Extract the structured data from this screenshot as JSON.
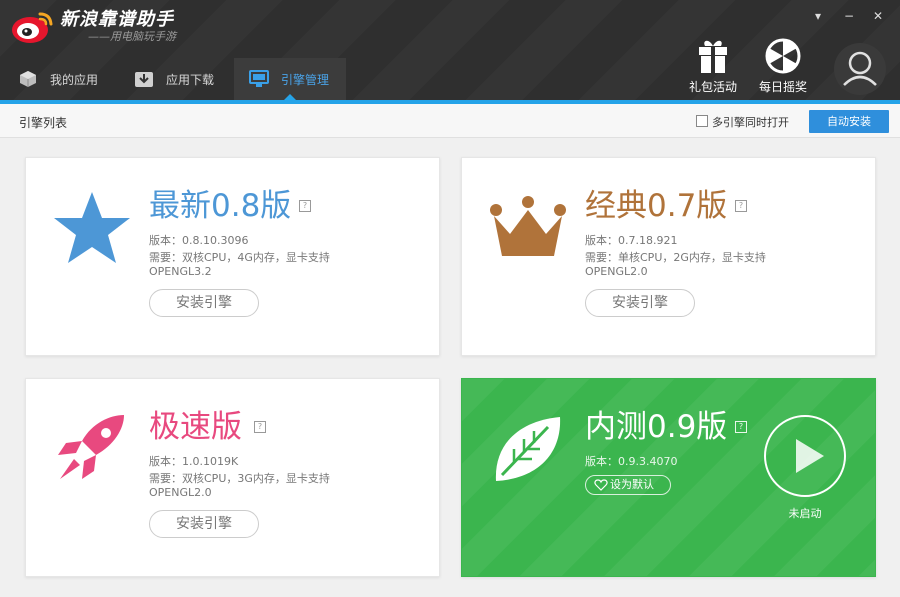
{
  "app": {
    "title": "新浪靠谱助手",
    "subtitle": "——用电脑玩手游",
    "window_controls": {
      "menu": "▾",
      "minimize": "−",
      "close": "✕"
    }
  },
  "nav": {
    "tabs": [
      {
        "label": "我的应用",
        "icon": "cube-icon",
        "active": false
      },
      {
        "label": "应用下载",
        "icon": "download-box-icon",
        "active": false
      },
      {
        "label": "引擎管理",
        "icon": "monitor-icon",
        "active": true
      }
    ]
  },
  "top_actions": {
    "gift": {
      "label": "礼包活动",
      "icon": "gift-icon"
    },
    "lottery": {
      "label": "每日摇奖",
      "icon": "lottery-wheel-icon"
    },
    "avatar_icon": "user-avatar-icon"
  },
  "toolbar": {
    "title": "引擎列表",
    "multi_open_label": "多引擎同时打开",
    "multi_open_checked": false,
    "auto_install_label": "自动安装"
  },
  "engines": [
    {
      "title": "最新0.8版",
      "title_color": "#4d97d6",
      "icon": "star-icon",
      "version": "版本：0.8.10.3096",
      "requirement": "需要：双核CPU，4G内存，显卡支持",
      "requirement2": "OPENGL3.2",
      "action_label": "安装引擎"
    },
    {
      "title": "经典0.7版",
      "title_color": "#b0733a",
      "icon": "crown-icon",
      "version": "版本：0.7.18.921",
      "requirement": "需要：单核CPU，2G内存，显卡支持",
      "requirement2": "OPENGL2.0",
      "action_label": "安装引擎"
    },
    {
      "title": "极速版",
      "title_color": "#e8497f",
      "icon": "rocket-icon",
      "version": "版本：1.0.1019K",
      "requirement": "需要：双核CPU，3G内存，显卡支持",
      "requirement2": "OPENGL2.0",
      "action_label": "安装引擎"
    },
    {
      "title": "内测0.9版",
      "title_color": "#ffffff",
      "icon": "leaf-icon",
      "version": "版本：0.9.3.4070",
      "default_label": "设为默认",
      "status_label": "未启动",
      "play_icon": "play-icon"
    }
  ],
  "colors": {
    "header_bg": "#2f2f2f",
    "accent_blue": "#25a3e8",
    "install_btn": "#2f8fdc",
    "green_card": "#3bb54e"
  }
}
